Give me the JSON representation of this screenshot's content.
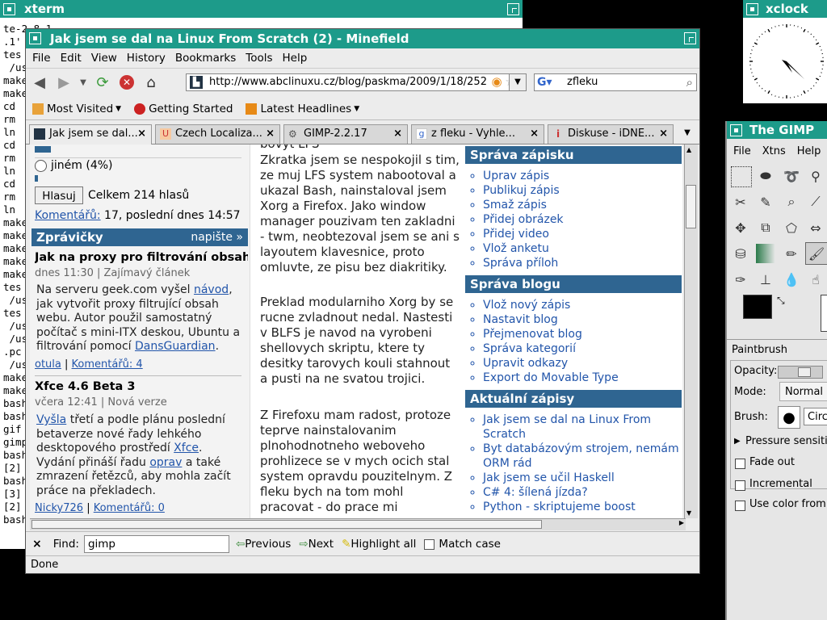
{
  "xterm": {
    "title": "xterm",
    "lines": [
      "te-2.8.1",
      ".1'",
      "tes",
      " /us",
      "make",
      "make",
      "cd",
      "rm",
      "ln",
      "cd",
      "rm",
      "ln",
      "cd",
      "rm",
      "ln",
      "make",
      "make",
      "make",
      "make",
      "make",
      "tes",
      " /us",
      "tes",
      " /us",
      " /us",
      ".pc",
      " /us",
      "make",
      "make",
      "bash",
      "bash",
      "gif",
      "gimp",
      "bash",
      "[2]",
      "bash",
      "[3]",
      "[2]",
      "bash"
    ]
  },
  "xclock": {
    "title": "xclock"
  },
  "gimp": {
    "title": "The GIMP",
    "menu": [
      "File",
      "Xtns",
      "Help"
    ],
    "tool_label": "Paintbrush",
    "opacity_label": "Opacity:",
    "mode_label": "Mode:",
    "mode_value": "Normal",
    "brush_label": "Brush:",
    "brush_value": "Circ",
    "pressure_label": "Pressure sensiti",
    "fade_out_label": "Fade out",
    "incremental_label": "Incremental",
    "use_color_label": "Use color from"
  },
  "firefox": {
    "title": "Jak jsem se dal na Linux From Scratch (2) - Minefield",
    "menu": [
      "File",
      "Edit",
      "View",
      "History",
      "Bookmarks",
      "Tools",
      "Help"
    ],
    "url": "http://www.abclinuxu.cz/blog/paskma/2009/1/18/252",
    "search_value": "zfleku",
    "bookmarks": [
      "Most Visited",
      "Getting Started",
      "Latest Headlines"
    ],
    "tabs": [
      "Jak jsem se dal...",
      "Czech Localiza...",
      "GIMP-2.2.17",
      "z fleku - Vyhle...",
      "Diskuse - iDNE..."
    ],
    "find_label": "Find:",
    "find_value": "gimp",
    "previous_label": "Previous",
    "next_label": "Next",
    "highlight_label": "Highlight all",
    "match_case_label": "Match case",
    "status": "Done"
  },
  "page": {
    "poll_option": "jiném (4%)",
    "vote_button": "Hlasuj",
    "vote_total": "Celkem 214 hlasů",
    "comments_link": "Komentářů:",
    "comments_text": "17, poslední dnes 14:57",
    "news_header": "Zprávičky",
    "news_write": "napište »",
    "news": [
      {
        "title": "Jak na proxy pro filtrování obsahu",
        "meta": "dnes 11:30 | Zajímavý článek",
        "text_a": "Na serveru geek.com vyšel ",
        "link1": "návod",
        "text_b": ", jak vytvořit proxy filtrující obsah webu. Autor použil samostatný počítač s mini-ITX deskou, Ubuntu a filtrování pomocí ",
        "link2": "DansGuardian",
        "text_c": ".",
        "author": "otula",
        "comments": "Komentářů: 4"
      },
      {
        "title": "Xfce 4.6 Beta 3",
        "meta": "včera 12:41 | Nová verze",
        "link0": "Vyšla",
        "text_a": " třetí a podle plánu poslední betaverze nové řady lehkého desktopového prostředí ",
        "link1": "Xfce",
        "text_b": ". Vydání přináší řadu ",
        "link2": "oprav",
        "text_c": " a také zmrazení řetězců, aby mohla začít práce na překladech.",
        "author": "Nicky726",
        "comments": "Komentářů: 0"
      }
    ],
    "top_partial": "bovyt LFS",
    "article": [
      "Zkratka jsem se nespokojil s tim, ze muj LFS system nabootoval a ukazal Bash, nainstaloval jsem Xorg a Firefox. Jako window manager pouzivam ten zakladni - twm, neobtezoval jsem se ani s layoutem klavesnice, proto omluvte, ze pisu bez diakritiky.",
      "Preklad modularniho Xorg by se rucne zvladnout nedal. Nastesti v BLFS je navod na vyrobeni shellovych skriptu, ktere ty desitky tarovych kouli stahnout a pusti na ne svatou trojici.",
      "Z Firefoxu mam radost, protoze teprve nainstalovanim plnohodnotneho weboveho prohlizece se v mych ocich stal system opravdu pouzitelnym. Z fleku bych na tom mohl pracovat - do prace mi"
    ],
    "sprava_zapisku": {
      "title": "Správa zápisku",
      "items": [
        "Uprav zápis",
        "Publikuj zápis",
        "Smaž zápis",
        "Přidej obrázek",
        "Přidej video",
        "Vlož anketu",
        "Správa příloh"
      ]
    },
    "sprava_blogu": {
      "title": "Správa blogu",
      "items": [
        "Vlož nový zápis",
        "Nastavit blog",
        "Přejmenovat blog",
        "Správa kategorií",
        "Upravit odkazy",
        "Export do Movable Type"
      ]
    },
    "aktualni": {
      "title": "Aktuální zápisy",
      "items": [
        "Jak jsem se dal na Linux From Scratch",
        "Byt databázovým strojem, nemám ORM rád",
        "Jak jsem se učil Haskell",
        "C# 4: šílená jízda?",
        "Python - skriptujeme boost"
      ]
    }
  },
  "colors": {
    "titlebar": "#1d9b8a",
    "section_header": "#2f6591",
    "link": "#2255aa"
  }
}
